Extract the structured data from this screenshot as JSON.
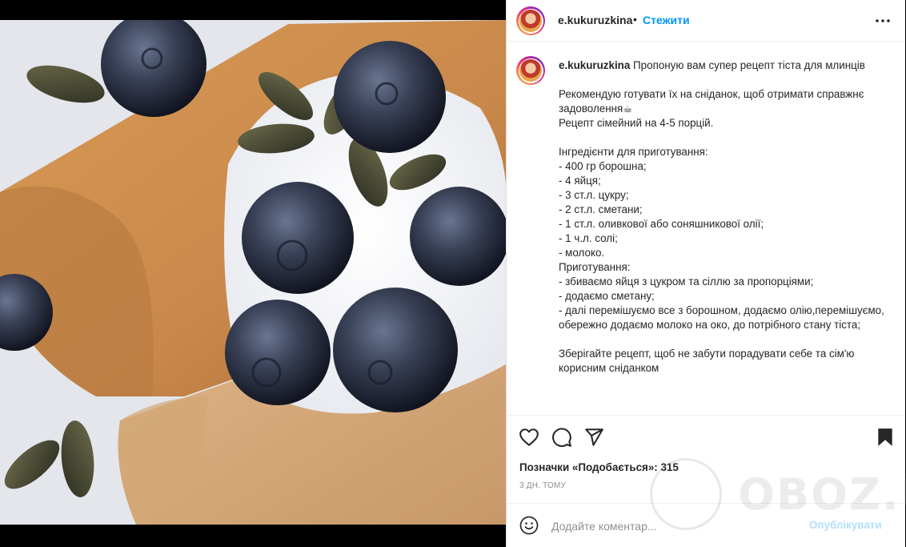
{
  "post": {
    "username": "e.kukuruzkina",
    "dot": "•",
    "follow_label": "Стежити",
    "caption": "Пропоную вам супер рецепт тіста для млинців\n\nРекомендую готувати їх на сніданок, щоб отримати справжнє задоволення☕\nРецепт сімейний на 4-5 порцій.\n\nІнгредієнти для приготування:\n- 400 гр борошна;\n- 4 яйця;\n- 3 ст.л. цукру;\n- 2 ст.л. сметани;\n- 1 ст.л. оливкової або соняшникової олії;\n- 1 ч.л. солі;\n- молоко.\nПриготування:\n- збиваємо яйця з цукром та сіллю за пропорціями;\n- додаємо сметану;\n- далі перемішуємо все з борошном, додаємо олію,перемішуємо, обережно додаємо молоко на око, до потрібного стану тіста;\n\nЗберігайте рецепт, щоб не забути порадувати себе та сім'ю корисним сніданком",
    "likes_label": "Позначки «Подобається»: 315",
    "time_ago": "3 ДН. ТОМУ",
    "comment_placeholder": "Додайте коментар...",
    "publish_label": "Опублікувати"
  },
  "icons": {
    "more": "more-horizontal-icon",
    "like": "heart-icon",
    "comment": "comment-icon",
    "share": "send-icon",
    "save": "bookmark-icon",
    "emoji": "emoji-icon"
  },
  "watermark": {
    "text": "OBOZ.UA"
  },
  "colors": {
    "accent": "#0095f6",
    "publish_disabled": "#b2dffc",
    "muted": "#8e8e8e"
  }
}
